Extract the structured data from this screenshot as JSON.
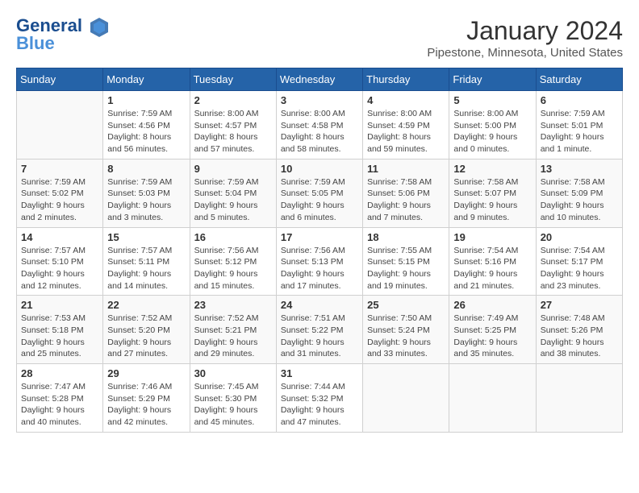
{
  "logo": {
    "line1": "General",
    "line2": "Blue"
  },
  "title": "January 2024",
  "location": "Pipestone, Minnesota, United States",
  "days_of_week": [
    "Sunday",
    "Monday",
    "Tuesday",
    "Wednesday",
    "Thursday",
    "Friday",
    "Saturday"
  ],
  "weeks": [
    [
      {
        "day": "",
        "info": ""
      },
      {
        "day": "1",
        "info": "Sunrise: 7:59 AM\nSunset: 4:56 PM\nDaylight: 8 hours\nand 56 minutes."
      },
      {
        "day": "2",
        "info": "Sunrise: 8:00 AM\nSunset: 4:57 PM\nDaylight: 8 hours\nand 57 minutes."
      },
      {
        "day": "3",
        "info": "Sunrise: 8:00 AM\nSunset: 4:58 PM\nDaylight: 8 hours\nand 58 minutes."
      },
      {
        "day": "4",
        "info": "Sunrise: 8:00 AM\nSunset: 4:59 PM\nDaylight: 8 hours\nand 59 minutes."
      },
      {
        "day": "5",
        "info": "Sunrise: 8:00 AM\nSunset: 5:00 PM\nDaylight: 9 hours\nand 0 minutes."
      },
      {
        "day": "6",
        "info": "Sunrise: 7:59 AM\nSunset: 5:01 PM\nDaylight: 9 hours\nand 1 minute."
      }
    ],
    [
      {
        "day": "7",
        "info": "Sunrise: 7:59 AM\nSunset: 5:02 PM\nDaylight: 9 hours\nand 2 minutes."
      },
      {
        "day": "8",
        "info": "Sunrise: 7:59 AM\nSunset: 5:03 PM\nDaylight: 9 hours\nand 3 minutes."
      },
      {
        "day": "9",
        "info": "Sunrise: 7:59 AM\nSunset: 5:04 PM\nDaylight: 9 hours\nand 5 minutes."
      },
      {
        "day": "10",
        "info": "Sunrise: 7:59 AM\nSunset: 5:05 PM\nDaylight: 9 hours\nand 6 minutes."
      },
      {
        "day": "11",
        "info": "Sunrise: 7:58 AM\nSunset: 5:06 PM\nDaylight: 9 hours\nand 7 minutes."
      },
      {
        "day": "12",
        "info": "Sunrise: 7:58 AM\nSunset: 5:07 PM\nDaylight: 9 hours\nand 9 minutes."
      },
      {
        "day": "13",
        "info": "Sunrise: 7:58 AM\nSunset: 5:09 PM\nDaylight: 9 hours\nand 10 minutes."
      }
    ],
    [
      {
        "day": "14",
        "info": "Sunrise: 7:57 AM\nSunset: 5:10 PM\nDaylight: 9 hours\nand 12 minutes."
      },
      {
        "day": "15",
        "info": "Sunrise: 7:57 AM\nSunset: 5:11 PM\nDaylight: 9 hours\nand 14 minutes."
      },
      {
        "day": "16",
        "info": "Sunrise: 7:56 AM\nSunset: 5:12 PM\nDaylight: 9 hours\nand 15 minutes."
      },
      {
        "day": "17",
        "info": "Sunrise: 7:56 AM\nSunset: 5:13 PM\nDaylight: 9 hours\nand 17 minutes."
      },
      {
        "day": "18",
        "info": "Sunrise: 7:55 AM\nSunset: 5:15 PM\nDaylight: 9 hours\nand 19 minutes."
      },
      {
        "day": "19",
        "info": "Sunrise: 7:54 AM\nSunset: 5:16 PM\nDaylight: 9 hours\nand 21 minutes."
      },
      {
        "day": "20",
        "info": "Sunrise: 7:54 AM\nSunset: 5:17 PM\nDaylight: 9 hours\nand 23 minutes."
      }
    ],
    [
      {
        "day": "21",
        "info": "Sunrise: 7:53 AM\nSunset: 5:18 PM\nDaylight: 9 hours\nand 25 minutes."
      },
      {
        "day": "22",
        "info": "Sunrise: 7:52 AM\nSunset: 5:20 PM\nDaylight: 9 hours\nand 27 minutes."
      },
      {
        "day": "23",
        "info": "Sunrise: 7:52 AM\nSunset: 5:21 PM\nDaylight: 9 hours\nand 29 minutes."
      },
      {
        "day": "24",
        "info": "Sunrise: 7:51 AM\nSunset: 5:22 PM\nDaylight: 9 hours\nand 31 minutes."
      },
      {
        "day": "25",
        "info": "Sunrise: 7:50 AM\nSunset: 5:24 PM\nDaylight: 9 hours\nand 33 minutes."
      },
      {
        "day": "26",
        "info": "Sunrise: 7:49 AM\nSunset: 5:25 PM\nDaylight: 9 hours\nand 35 minutes."
      },
      {
        "day": "27",
        "info": "Sunrise: 7:48 AM\nSunset: 5:26 PM\nDaylight: 9 hours\nand 38 minutes."
      }
    ],
    [
      {
        "day": "28",
        "info": "Sunrise: 7:47 AM\nSunset: 5:28 PM\nDaylight: 9 hours\nand 40 minutes."
      },
      {
        "day": "29",
        "info": "Sunrise: 7:46 AM\nSunset: 5:29 PM\nDaylight: 9 hours\nand 42 minutes."
      },
      {
        "day": "30",
        "info": "Sunrise: 7:45 AM\nSunset: 5:30 PM\nDaylight: 9 hours\nand 45 minutes."
      },
      {
        "day": "31",
        "info": "Sunrise: 7:44 AM\nSunset: 5:32 PM\nDaylight: 9 hours\nand 47 minutes."
      },
      {
        "day": "",
        "info": ""
      },
      {
        "day": "",
        "info": ""
      },
      {
        "day": "",
        "info": ""
      }
    ]
  ]
}
